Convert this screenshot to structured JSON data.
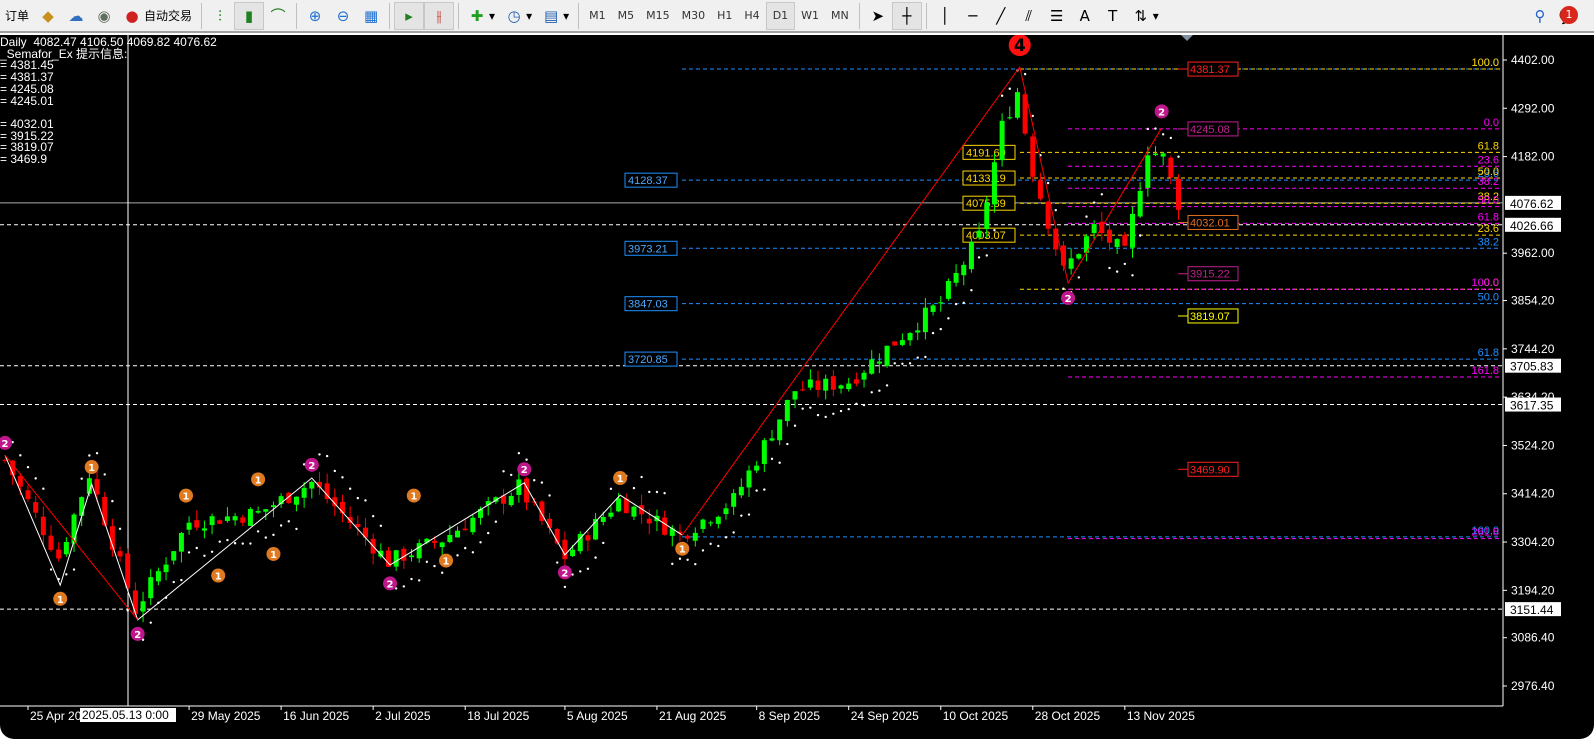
{
  "toolbar": {
    "new_order": "订单",
    "auto_trading": "自动交易",
    "timeframes": [
      "M1",
      "M5",
      "M15",
      "M30",
      "H1",
      "H4",
      "D1",
      "W1",
      "MN"
    ],
    "active_timeframe": "D1",
    "notifications": "1"
  },
  "info": {
    "header": "Daily  4082.47 4106.50 4069.82 4076.62",
    "indicator": "_Semafor_Ex 提示信息:",
    "lines": [
      "= 4381.45",
      "= 4381.37",
      "= 4245.08",
      "= 4245.01",
      "",
      "= 4032.01",
      "= 3915.22",
      "= 3819.07",
      "= 3469.9"
    ]
  },
  "chart_data": {
    "type": "candlestick",
    "symbol_period": "Daily",
    "ylim": [
      2976.4,
      4402.0
    ],
    "y_ticks": [
      "4402.00",
      "4292.00",
      "4182.00",
      "3962.00",
      "3854.20",
      "3744.20",
      "3634.20",
      "3524.20",
      "3414.20",
      "3304.20",
      "3194.20",
      "3086.40",
      "2976.40"
    ],
    "x_ticks": [
      {
        "i": 3,
        "t": "25 Apr 2025"
      },
      {
        "i": 24,
        "t": "29 May 2025"
      },
      {
        "i": 36,
        "t": "16 Jun 2025"
      },
      {
        "i": 48,
        "t": "2 Jul 2025"
      },
      {
        "i": 60,
        "t": "18 Jul 2025"
      },
      {
        "i": 73,
        "t": "5 Aug 2025"
      },
      {
        "i": 85,
        "t": "21 Aug 2025"
      },
      {
        "i": 98,
        "t": "8 Sep 2025"
      },
      {
        "i": 110,
        "t": "24 Sep 2025"
      },
      {
        "i": 122,
        "t": "10 Oct 2025"
      },
      {
        "i": 134,
        "t": "28 Oct 2025"
      },
      {
        "i": 146,
        "t": "13 Nov 2025"
      }
    ],
    "crosshair_label": "2025.05.13 0:00",
    "price_path": [
      [
        0,
        3490
      ],
      [
        7,
        3270
      ],
      [
        11,
        3460
      ],
      [
        17,
        3150
      ],
      [
        24,
        3350
      ],
      [
        33,
        3370
      ],
      [
        40,
        3440
      ],
      [
        50,
        3260
      ],
      [
        57,
        3310
      ],
      [
        67,
        3430
      ],
      [
        73,
        3270
      ],
      [
        80,
        3400
      ],
      [
        88,
        3320
      ],
      [
        95,
        3400
      ],
      [
        103,
        3650
      ],
      [
        110,
        3670
      ],
      [
        116,
        3760
      ],
      [
        122,
        3850
      ],
      [
        127,
        4000
      ],
      [
        130,
        4250
      ],
      [
        132,
        4330
      ],
      [
        134,
        4150
      ],
      [
        138,
        3920
      ],
      [
        142,
        4020
      ],
      [
        146,
        3960
      ],
      [
        149,
        4200
      ],
      [
        151,
        4180
      ],
      [
        153,
        4076
      ]
    ],
    "axis_marks": [
      {
        "p": 4076.62,
        "t": "4076.62"
      },
      {
        "p": 4026.66,
        "t": "4026.66"
      },
      {
        "p": 3705.83,
        "t": "3705.83"
      },
      {
        "p": 3617.35,
        "t": "3617.35"
      },
      {
        "p": 3151.44,
        "t": "3151.44"
      }
    ],
    "fib_blue": {
      "color": "#1e90ff",
      "levels": [
        {
          "p": 4381.37,
          "t": "0.0"
        },
        {
          "p": 4128.37,
          "t": "23.6",
          "box": "4128.37"
        },
        {
          "p": 3973.21,
          "t": "38.2",
          "box": "3973.21"
        },
        {
          "p": 3847.03,
          "t": "50.0",
          "box": "3847.03"
        },
        {
          "p": 3720.85,
          "t": "61.8",
          "box": "3720.85"
        },
        {
          "p": 3316,
          "t": "100.0"
        }
      ]
    },
    "fib_yellow": {
      "color": "#ffd700",
      "levels": [
        {
          "p": 4381.37,
          "t": "100.0"
        },
        {
          "p": 4191.69,
          "t": "61.8",
          "box": "4191.69"
        },
        {
          "p": 4133.19,
          "t": "50.0",
          "box": "4133.19"
        },
        {
          "p": 4075.89,
          "t": "38.2",
          "box": "4075.89"
        },
        {
          "p": 4003.07,
          "t": "23.6",
          "box": "4003.07"
        },
        {
          "p": 3880,
          "t": "0.0"
        }
      ]
    },
    "fib_magenta": {
      "color": "#ff00ff",
      "levels": [
        {
          "p": 4245.08,
          "t": "0.0"
        },
        {
          "p": 4160,
          "t": "23.6"
        },
        {
          "p": 4110,
          "t": "38.2"
        },
        {
          "p": 4068,
          "t": "50.0"
        },
        {
          "p": 4030,
          "t": "61.8"
        },
        {
          "p": 3880,
          "t": "100.0"
        },
        {
          "p": 3680,
          "t": "161.8"
        },
        {
          "p": 3312,
          "t": "261.8"
        }
      ]
    },
    "semafor_labels": [
      {
        "p": 4381.37,
        "t": "4381.37",
        "c": "#ff2020"
      },
      {
        "p": 4245.08,
        "t": "4245.08",
        "c": "#c02090"
      },
      {
        "p": 4032.01,
        "t": "4032.01",
        "c": "#e07020"
      },
      {
        "p": 3915.22,
        "t": "3915.22",
        "c": "#c02090"
      },
      {
        "p": 3819.07,
        "t": "3819.07",
        "c": "#ffff00"
      },
      {
        "p": 3469.9,
        "t": "3469.90",
        "c": "#ff2020"
      }
    ],
    "semafor_points": [
      {
        "i": 0,
        "p": 3530,
        "n": "2"
      },
      {
        "i": 17.3,
        "p": 3095,
        "n": "2"
      },
      {
        "i": 40,
        "p": 3480,
        "n": "2"
      },
      {
        "i": 50.2,
        "p": 3210,
        "n": "2"
      },
      {
        "i": 67.7,
        "p": 3470,
        "n": "2"
      },
      {
        "i": 73,
        "p": 3235,
        "n": "2"
      },
      {
        "i": 138.6,
        "p": 3860,
        "n": "2"
      },
      {
        "i": 150.8,
        "p": 4285,
        "n": "2"
      },
      {
        "i": 7.2,
        "p": 3175,
        "n": "1"
      },
      {
        "i": 11.3,
        "p": 3475,
        "n": "1"
      },
      {
        "i": 23.6,
        "p": 3410,
        "n": "1"
      },
      {
        "i": 27.8,
        "p": 3228,
        "n": "1"
      },
      {
        "i": 33,
        "p": 3447,
        "n": "1"
      },
      {
        "i": 35,
        "p": 3277,
        "n": "1"
      },
      {
        "i": 53.3,
        "p": 3410,
        "n": "1"
      },
      {
        "i": 57.5,
        "p": 3262,
        "n": "1"
      },
      {
        "i": 80.2,
        "p": 3450,
        "n": "1"
      },
      {
        "i": 88.3,
        "p": 3289,
        "n": "1"
      },
      {
        "i": 132.3,
        "p": 4436,
        "n": "4"
      }
    ],
    "zigzag_white": [
      [
        0,
        3502
      ],
      [
        7.2,
        3206
      ],
      [
        11.3,
        3436
      ],
      [
        17.3,
        3127
      ],
      [
        40,
        3450
      ],
      [
        50.2,
        3252
      ],
      [
        67.7,
        3439
      ],
      [
        73,
        3275
      ],
      [
        80.2,
        3411
      ],
      [
        88.3,
        3320
      ]
    ],
    "zigzag_red": [
      [
        [
          0,
          3502
        ],
        [
          17.3,
          3127
        ]
      ],
      [
        [
          88.3,
          3320
        ],
        [
          132.3,
          4386
        ],
        [
          138.6,
          3894
        ],
        [
          150.8,
          4247
        ]
      ]
    ]
  }
}
